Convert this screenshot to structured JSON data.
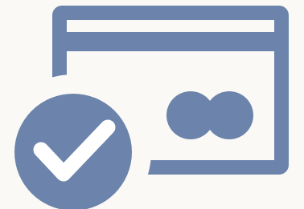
{
  "icon": {
    "name": "card-verified-icon",
    "parts": [
      "credit-card-icon",
      "card-stripe",
      "card-chip-circles",
      "check-badge-icon",
      "checkmark-icon"
    ]
  },
  "colors": {
    "background": "#fbf9f6",
    "icon": "#6c84ab",
    "cutout": "#fbf9f6",
    "check": "#ffffff"
  }
}
